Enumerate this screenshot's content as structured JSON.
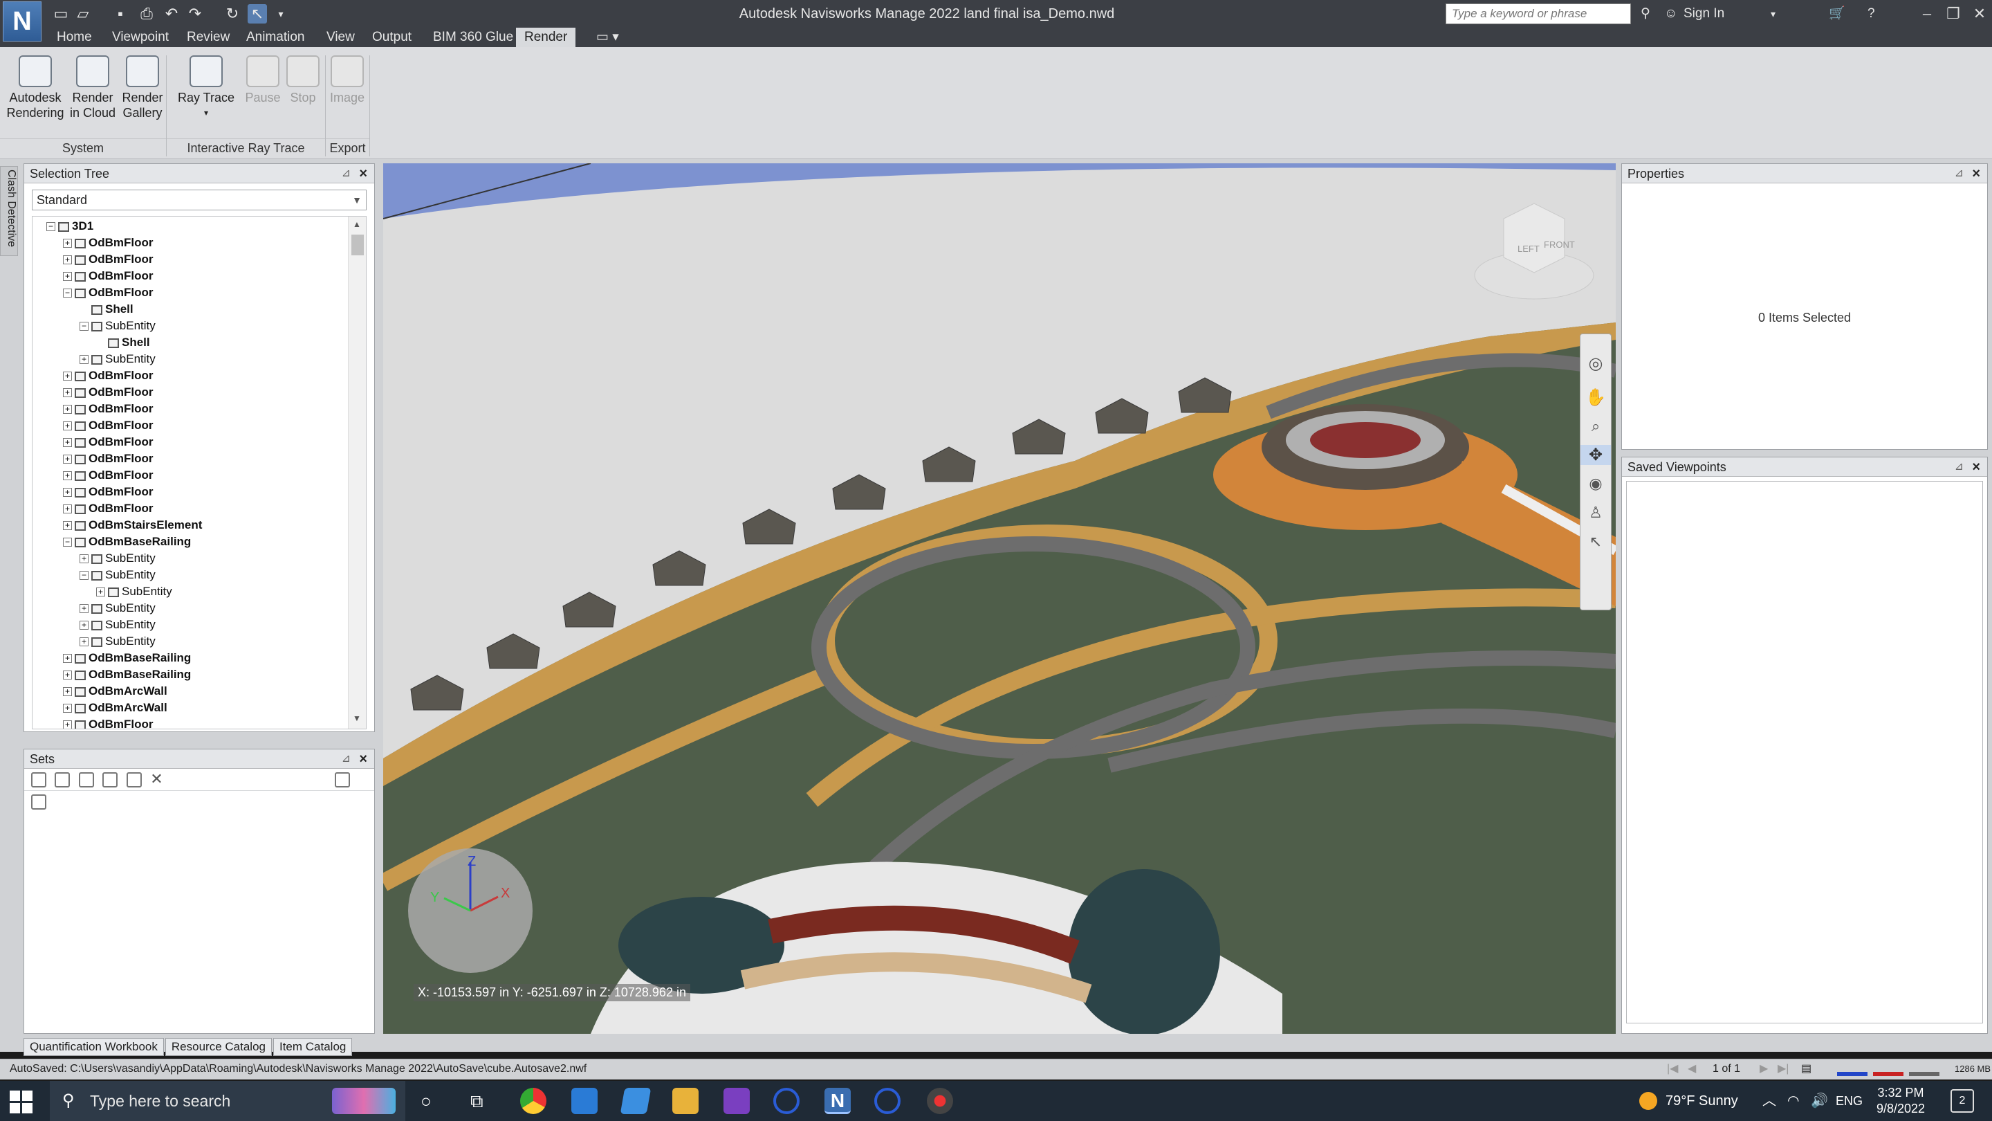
{
  "titlebar": {
    "title": "Autodesk Navisworks Manage 2022     land final isa_Demo.nwd",
    "search_placeholder": "Type a keyword or phrase",
    "sign_in": "Sign In"
  },
  "menu": {
    "tabs": [
      "Home",
      "Viewpoint",
      "Review",
      "Animation",
      "View",
      "Output",
      "BIM 360 Glue",
      "Render"
    ],
    "active": "Render"
  },
  "ribbon": {
    "buttons": [
      {
        "label": "Autodesk\nRendering",
        "line1": "Autodesk",
        "line2": "Rendering",
        "enabled": true
      },
      {
        "label": "Render in Cloud",
        "line1": "Render",
        "line2": "in Cloud",
        "enabled": true
      },
      {
        "label": "Render Gallery",
        "line1": "Render",
        "line2": "Gallery",
        "enabled": true
      },
      {
        "label": "Ray Trace",
        "line1": "Ray Trace",
        "line2": "▾",
        "enabled": true
      },
      {
        "label": "Pause",
        "line1": "Pause",
        "line2": "",
        "enabled": false
      },
      {
        "label": "Stop",
        "line1": "Stop",
        "line2": "",
        "enabled": false
      },
      {
        "label": "Image",
        "line1": "Image",
        "line2": "",
        "enabled": false
      }
    ],
    "groups": [
      "System",
      "Interactive Ray Trace",
      "Export"
    ]
  },
  "left_strip": {
    "label": "Clash Detective"
  },
  "selection_tree": {
    "title": "Selection Tree",
    "mode": "Standard",
    "items": [
      {
        "label": "3D1",
        "level": 0,
        "exp": "−",
        "bold": true
      },
      {
        "label": "OdBmFloor",
        "level": 1,
        "exp": "+",
        "bold": true
      },
      {
        "label": "OdBmFloor",
        "level": 1,
        "exp": "+",
        "bold": true
      },
      {
        "label": "OdBmFloor",
        "level": 1,
        "exp": "+",
        "bold": true
      },
      {
        "label": "OdBmFloor",
        "level": 1,
        "exp": "−",
        "bold": true
      },
      {
        "label": "Shell",
        "level": 2,
        "exp": "",
        "bold": true
      },
      {
        "label": "SubEntity",
        "level": 2,
        "exp": "−",
        "bold": false
      },
      {
        "label": "Shell",
        "level": 3,
        "exp": "",
        "bold": true
      },
      {
        "label": "SubEntity",
        "level": 2,
        "exp": "+",
        "bold": false
      },
      {
        "label": "OdBmFloor",
        "level": 1,
        "exp": "+",
        "bold": true
      },
      {
        "label": "OdBmFloor",
        "level": 1,
        "exp": "+",
        "bold": true
      },
      {
        "label": "OdBmFloor",
        "level": 1,
        "exp": "+",
        "bold": true
      },
      {
        "label": "OdBmFloor",
        "level": 1,
        "exp": "+",
        "bold": true
      },
      {
        "label": "OdBmFloor",
        "level": 1,
        "exp": "+",
        "bold": true
      },
      {
        "label": "OdBmFloor",
        "level": 1,
        "exp": "+",
        "bold": true
      },
      {
        "label": "OdBmFloor",
        "level": 1,
        "exp": "+",
        "bold": true
      },
      {
        "label": "OdBmFloor",
        "level": 1,
        "exp": "+",
        "bold": true
      },
      {
        "label": "OdBmFloor",
        "level": 1,
        "exp": "+",
        "bold": true
      },
      {
        "label": "OdBmStairsElement",
        "level": 1,
        "exp": "+",
        "bold": true
      },
      {
        "label": "OdBmBaseRailing",
        "level": 1,
        "exp": "−",
        "bold": true
      },
      {
        "label": "SubEntity",
        "level": 2,
        "exp": "+",
        "bold": false
      },
      {
        "label": "SubEntity",
        "level": 2,
        "exp": "−",
        "bold": false
      },
      {
        "label": "SubEntity",
        "level": 3,
        "exp": "+",
        "bold": false
      },
      {
        "label": "SubEntity",
        "level": 2,
        "exp": "+",
        "bold": false
      },
      {
        "label": "SubEntity",
        "level": 2,
        "exp": "+",
        "bold": false
      },
      {
        "label": "SubEntity",
        "level": 2,
        "exp": "+",
        "bold": false
      },
      {
        "label": "OdBmBaseRailing",
        "level": 1,
        "exp": "+",
        "bold": true
      },
      {
        "label": "OdBmBaseRailing",
        "level": 1,
        "exp": "+",
        "bold": true
      },
      {
        "label": "OdBmArcWall",
        "level": 1,
        "exp": "+",
        "bold": true
      },
      {
        "label": "OdBmArcWall",
        "level": 1,
        "exp": "+",
        "bold": true
      },
      {
        "label": "OdBmFloor",
        "level": 1,
        "exp": "+",
        "bold": true
      }
    ]
  },
  "sets": {
    "title": "Sets"
  },
  "viewport": {
    "coords": "X: -10153.597 in  Y: -6251.697 in  Z: 10728.962 in",
    "cube_left": "LEFT",
    "cube_front": "FRONT",
    "axis_z": "Z",
    "axis_x": "X",
    "axis_y": "Y"
  },
  "properties": {
    "title": "Properties",
    "empty": "0 Items Selected"
  },
  "saved_viewpoints": {
    "title": "Saved Viewpoints"
  },
  "bottom_tabs": [
    "Quantification Workbook",
    "Resource Catalog",
    "Item Catalog"
  ],
  "status": {
    "autosaved": "AutoSaved: C:\\Users\\vasandiy\\AppData\\Roaming\\Autodesk\\Navisworks Manage 2022\\AutoSave\\cube.Autosave2.nwf",
    "page": "1 of 1",
    "memory": "1286 MB"
  },
  "taskbar": {
    "search_placeholder": "Type here to search",
    "weather": "79°F  Sunny",
    "lang": "ENG",
    "time": "3:32 PM",
    "date": "9/8/2022",
    "notifications": "2"
  }
}
